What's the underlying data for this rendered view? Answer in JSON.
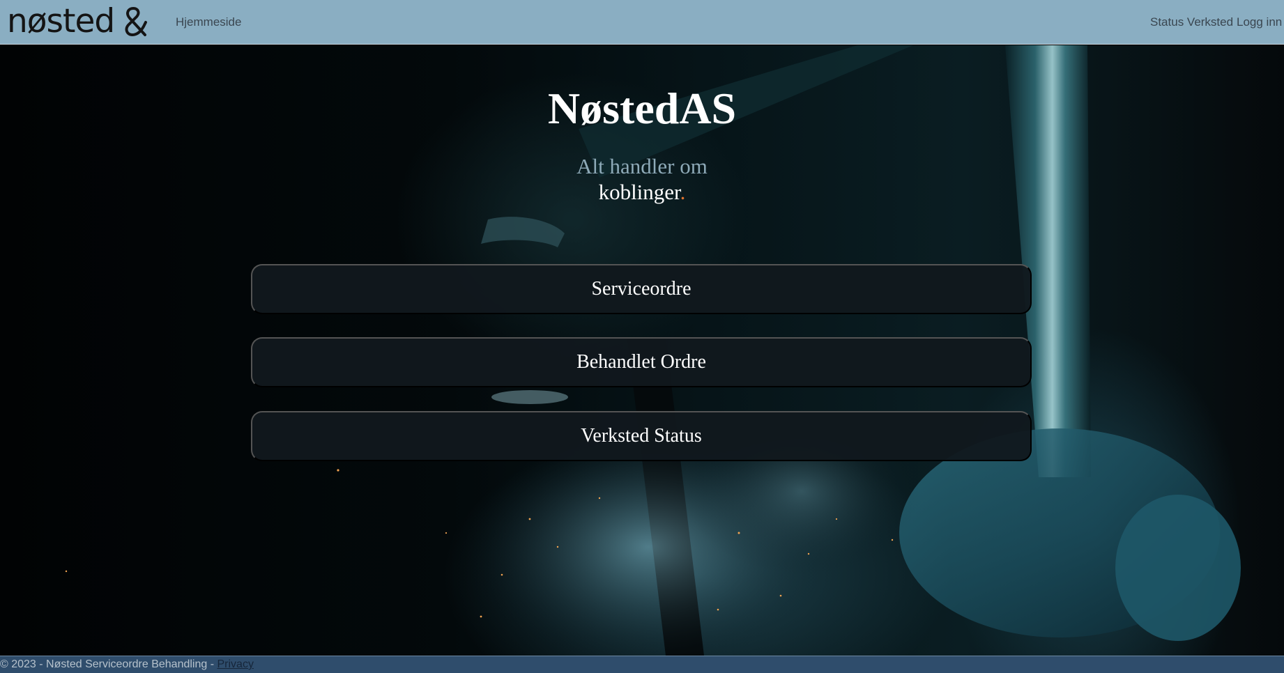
{
  "navbar": {
    "brand": "nøsted",
    "links": {
      "home": "Hjemmeside",
      "status": "Status Verksted",
      "login": "Logg inn"
    }
  },
  "hero": {
    "title": "NøstedAS",
    "tagline_line1": "Alt handler om",
    "tagline_line2": "koblinger",
    "tagline_dot": "."
  },
  "menu": {
    "items": [
      {
        "label": "Serviceordre"
      },
      {
        "label": "Behandlet Ordre"
      },
      {
        "label": "Verksted Status"
      }
    ]
  },
  "footer": {
    "text": "© 2023 - Nøsted Serviceordre Behandling - ",
    "privacy_label": "Privacy"
  },
  "colors": {
    "navbar_bg": "#8aaec2",
    "footer_bg": "#2f4d6c",
    "button_bg": "#11181e",
    "accent_dot": "#e0742e"
  }
}
